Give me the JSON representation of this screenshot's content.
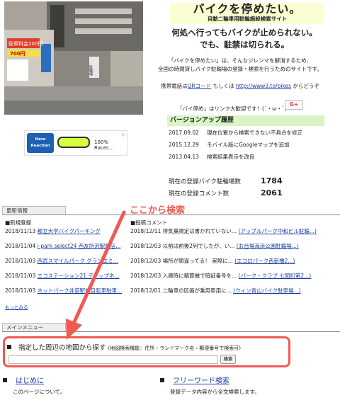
{
  "photo": {
    "signs": [
      "駐車料金200円",
      "700円",
      "駐輪場"
    ]
  },
  "brand": {
    "title": "バイクを停めたい。",
    "subtitle": "自動二輪車用駐輪施設検索サイト"
  },
  "catch": {
    "line1": "何処へ行ってもバイクが止められない。",
    "line2": "でも、駐禁は切られる。"
  },
  "intro": {
    "line1": "「バイクを停めたい」は、そんなジレンマを解消するため、",
    "line2": "全国の時間貸しバイク駐輪場の登録・検索を行うためのサイトです。"
  },
  "mobile": {
    "prefix": "携帯電話は",
    "qr_link": "QRコード",
    "middle": " もしくは ",
    "url_link": "http://www3.to/bikes",
    "suffix": " からどうぞ"
  },
  "link_free": "「バイ停め」はリンク大歓迎です！(´・ω・`)",
  "gplus": "G+",
  "history": {
    "title": "バージョンアップ履歴",
    "rows": [
      {
        "date": "2017.09.02",
        "text": "現在位置から検索できない不具合を修正"
      },
      {
        "date": "2015.12.29",
        "text": "モバイル版にGoogleマップを追加"
      },
      {
        "date": "2013.04.13",
        "text": "検索結果表示を改良"
      }
    ]
  },
  "stats": {
    "parking_label": "現在の登録バイク駐輪場数",
    "parking_count": "1784",
    "comment_label": "現在の登録コメント数",
    "comment_count": "2061"
  },
  "ad": {
    "logo": "Hero Reaction",
    "text": "100% Racec...",
    "choice": "▷"
  },
  "callout": "ここから検索",
  "updates_tab": "更新情報",
  "updates": {
    "new_heading": "■新規登録",
    "new_items": [
      {
        "date": "2018/11/13",
        "link": "都立大学バイクパーキング"
      },
      {
        "date": "2018/11/04",
        "link": "i-park select24 西友所沢駅前店..."
      },
      {
        "date": "2018/11/03",
        "link": "西武スマイルパーク グランエミ..."
      },
      {
        "date": "2018/11/03",
        "link": "エコステーション21 ディップネ..."
      },
      {
        "date": "2018/11/03",
        "link": "ネットパーク井荻駅前自転車駐車..."
      }
    ],
    "more": "もっとみる",
    "comment_heading": "■投稿コメント",
    "comment_items": [
      {
        "date": "2018/12/11",
        "text": "排気量規定は書かれていない...",
        "link": "(アップルパーク中和ビル駐輪...)"
      },
      {
        "date": "2018/12/03",
        "text": "以前は前後2列でしたが、い...",
        "link": "(お台場海浜公園駐輪場...)"
      },
      {
        "date": "2018/12/03",
        "text": "場所が間違ってる！ 実際に...",
        "link": "(エコロパーク西新橋2...)"
      },
      {
        "date": "2018/12/03",
        "text": "入庫時に精算機で暗証番号を...",
        "link": "(パーク・クラブ 七間町第2...)"
      },
      {
        "date": "2018/12/01",
        "text": "二輪車の区画が乗用車用に...",
        "link": "(ウィン青山バイク駐車場...)"
      }
    ]
  },
  "menu_tab": "メインメニュー",
  "search": {
    "title": "指定した周辺の地図から探す",
    "note": "(地図検索機能：住所・ランドマーク名・郵便番号で検索可)",
    "placeholder": "",
    "button": "検索"
  },
  "menu": {
    "intro_link": "はじめに",
    "intro_desc": "このページについて。",
    "freeword_link": "フリーワード検索",
    "freeword_desc": "登録データ内容から全文検索します。"
  },
  "colors": {
    "callout": "#f05a52",
    "history_bg": "#d9f5c5",
    "brand_bg": "#fbfed2",
    "link": "#1a3fa0"
  }
}
